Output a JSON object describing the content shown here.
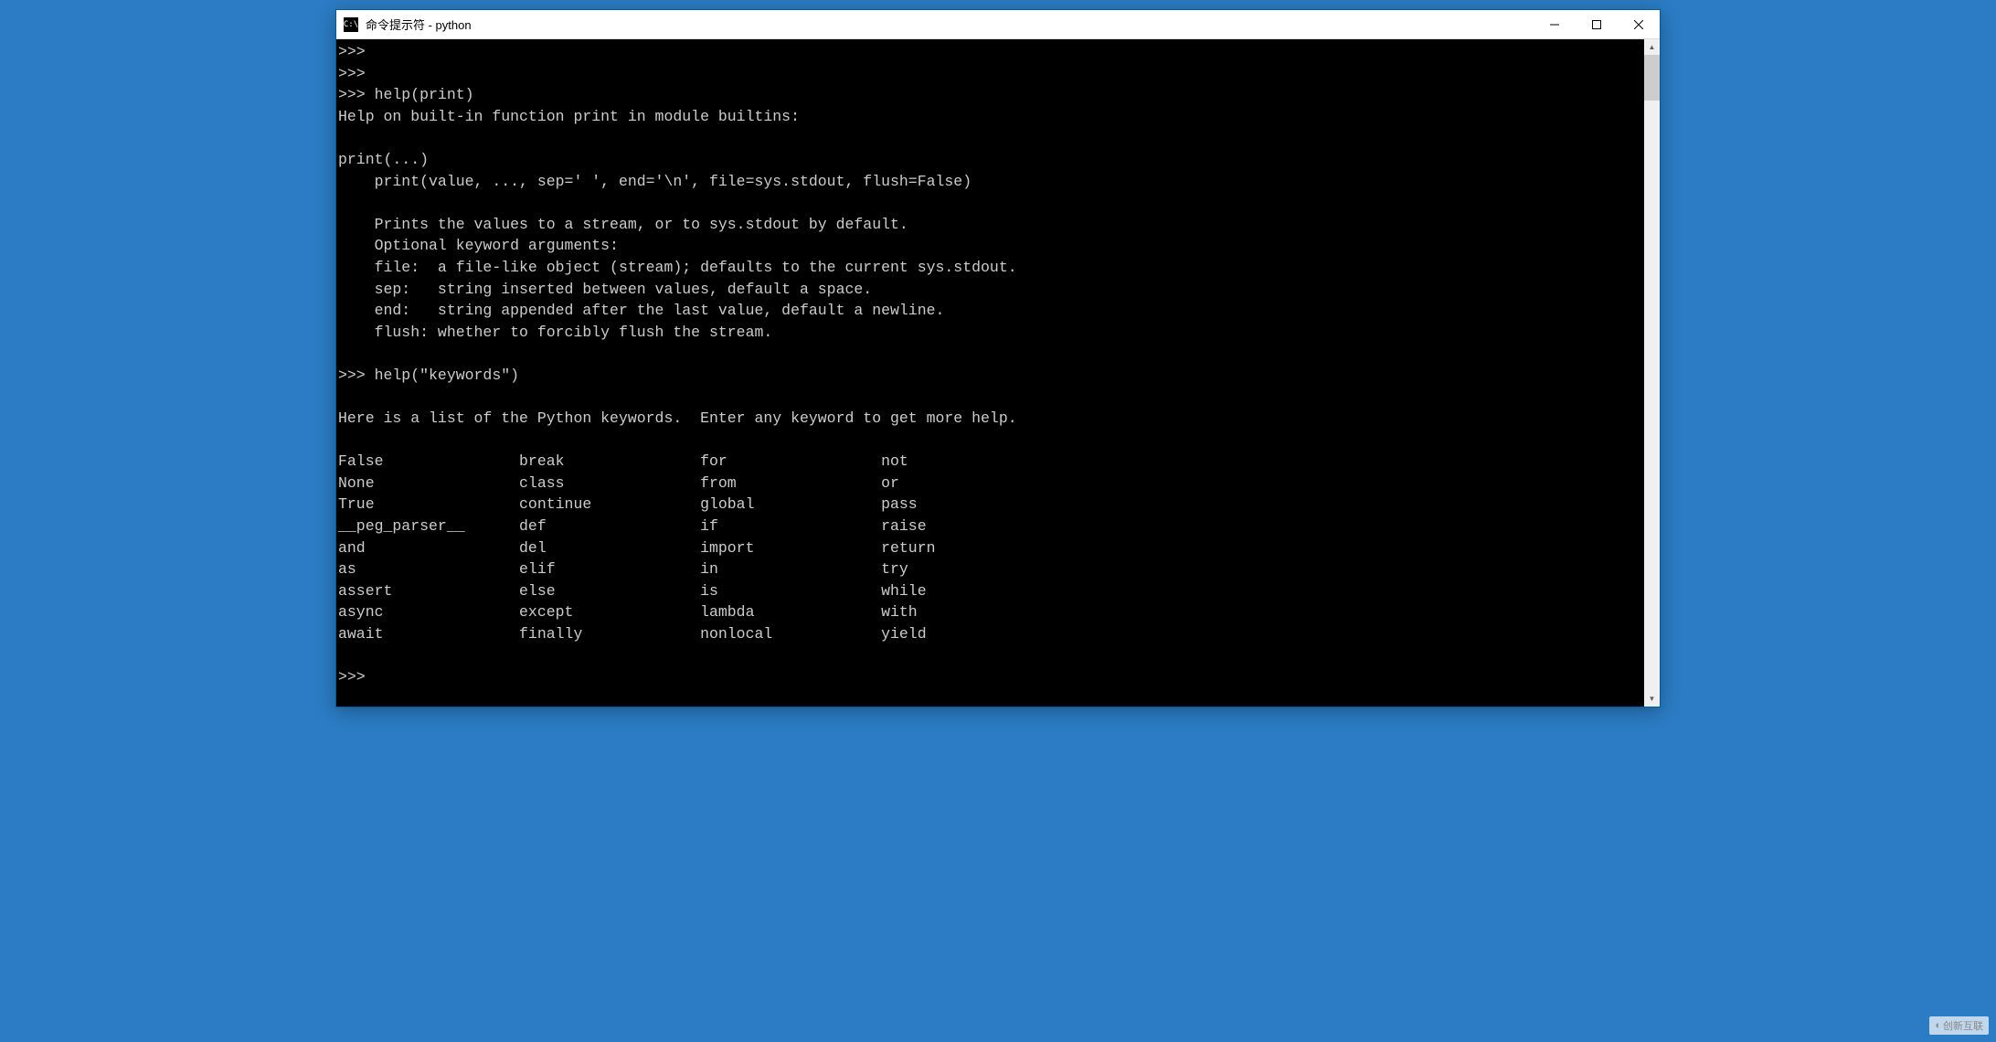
{
  "window": {
    "title": "命令提示符 - python",
    "icon_label": "C:\\"
  },
  "terminal": {
    "lines": [
      ">>>",
      ">>>",
      ">>> help(print)",
      "Help on built-in function print in module builtins:",
      "",
      "print(...)",
      "    print(value, ..., sep=' ', end='\\n', file=sys.stdout, flush=False)",
      "",
      "    Prints the values to a stream, or to sys.stdout by default.",
      "    Optional keyword arguments:",
      "    file:  a file-like object (stream); defaults to the current sys.stdout.",
      "    sep:   string inserted between values, default a space.",
      "    end:   string appended after the last value, default a newline.",
      "    flush: whether to forcibly flush the stream.",
      "",
      ">>> help(\"keywords\")",
      "",
      "Here is a list of the Python keywords.  Enter any keyword to get more help.",
      "",
      "False               break               for                 not",
      "None                class               from                or",
      "True                continue            global              pass",
      "__peg_parser__      def                 if                  raise",
      "and                 del                 import              return",
      "as                  elif                in                  try",
      "assert              else                is                  while",
      "async               except              lambda              with",
      "await               finally             nonlocal            yield",
      "",
      ">>>"
    ]
  },
  "watermark": {
    "text": "创新互联"
  }
}
